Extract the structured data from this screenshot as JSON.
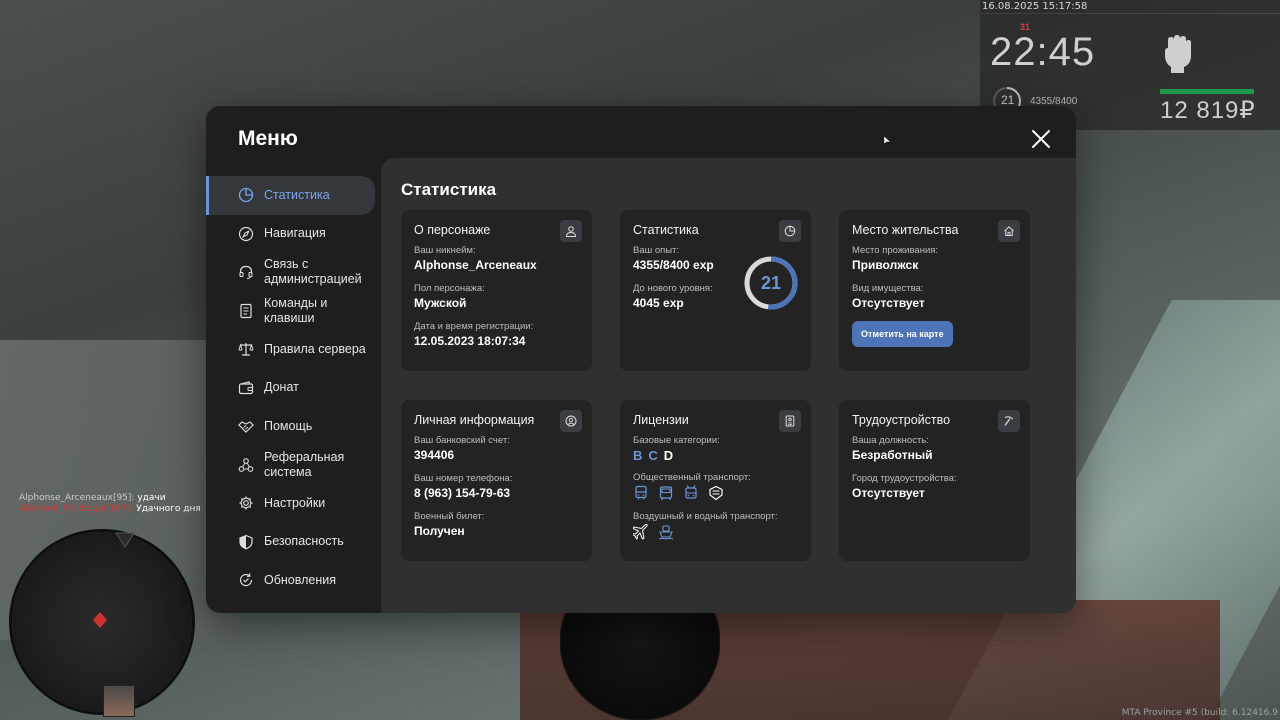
{
  "hud": {
    "datetime": "16.08.2025 15:17:58",
    "time": "22:45",
    "small_tag": "31",
    "level": "21",
    "exp": "4355/8400",
    "money": "12 819₽"
  },
  "chat": [
    {
      "name": "Alphonse_Arceneaux[95]:",
      "text": " удачи"
    },
    {
      "name": "Alambek_Molibogol[107]:",
      "text": " Удачного дня"
    }
  ],
  "build_text": "MTA Province #5 (build: 6.12416.9",
  "menu": {
    "title": "Меню",
    "nav": [
      {
        "label": "Статистика",
        "icon": "pie-chart-icon",
        "active": true
      },
      {
        "label": "Навигация",
        "icon": "compass-icon"
      },
      {
        "label": "Связь с администрацией",
        "icon": "headset-icon"
      },
      {
        "label": "Команды и клавиши",
        "icon": "document-icon"
      },
      {
        "label": "Правила сервера",
        "icon": "scales-icon"
      },
      {
        "label": "Донат",
        "icon": "wallet-icon"
      },
      {
        "label": "Помощь",
        "icon": "handshake-icon"
      },
      {
        "label": "Реферальная система",
        "icon": "network-icon"
      },
      {
        "label": "Настройки",
        "icon": "gear-icon"
      },
      {
        "label": "Безопасность",
        "icon": "shield-icon"
      },
      {
        "label": "Обновления",
        "icon": "refresh-icon"
      }
    ],
    "content_title": "Статистика",
    "cards": {
      "character": {
        "title": "О персонаже",
        "icon": "user-icon",
        "fields": [
          {
            "label": "Ваш никнейм:",
            "value": "Alphonse_Arceneaux"
          },
          {
            "label": "Пол персонажа:",
            "value": "Мужской"
          },
          {
            "label": "Дата и время регистрации:",
            "value": "12.05.2023 18:07:34"
          }
        ]
      },
      "stats": {
        "title": "Статистика",
        "icon": "pie-chart-icon",
        "fields": [
          {
            "label": "Ваш опыт:",
            "value": "4355/8400 exp"
          },
          {
            "label": "До нового уровня:",
            "value": "4045 exp"
          }
        ],
        "level": "21",
        "level_progress": 0.518
      },
      "residence": {
        "title": "Место жительства",
        "icon": "home-icon",
        "fields": [
          {
            "label": "Место проживания:",
            "value": "Приволжск"
          },
          {
            "label": "Вид имущества:",
            "value": "Отсутствует"
          }
        ],
        "button": "Отметить на карте"
      },
      "personal": {
        "title": "Личная информация",
        "icon": "user-circle-icon",
        "fields": [
          {
            "label": "Ваш банковский счет:",
            "value": "394406"
          },
          {
            "label": "Ваш номер телефона:",
            "value": "8 (963) 154-79-63"
          },
          {
            "label": "Военный билет:",
            "value": "Получен"
          }
        ]
      },
      "licenses": {
        "title": "Лицензии",
        "icon": "id-card-icon",
        "basic_label": "Базовые категории:",
        "categories": [
          "B",
          "C",
          "D"
        ],
        "public_label": "Общественный транспорт:",
        "air_label": "Воздушный и водный транспорт:"
      },
      "employment": {
        "title": "Трудоустройство",
        "icon": "pickaxe-icon",
        "fields": [
          {
            "label": "Ваша должность:",
            "value": "Безработный"
          },
          {
            "label": "Город трудоустройства:",
            "value": "Отсутствует"
          }
        ]
      }
    }
  },
  "colors": {
    "accent": "#6d95d8",
    "button": "#4d74b8",
    "panel": "#1e1e1e",
    "content": "#303030",
    "card": "#232323",
    "money_bar": "#1f9a4b"
  }
}
